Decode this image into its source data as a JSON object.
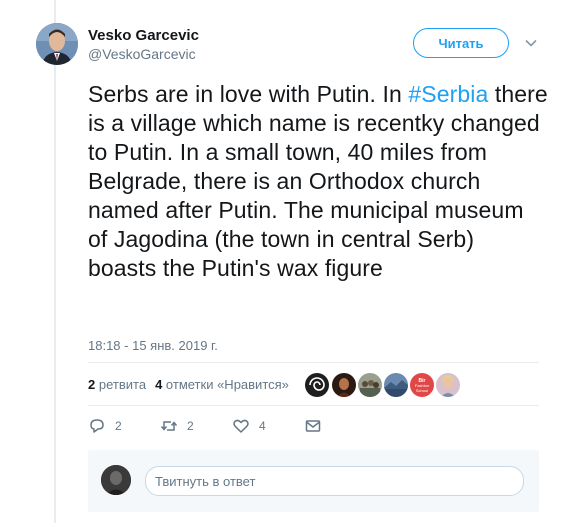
{
  "author": {
    "name": "Vesko Garcevic",
    "handle": "@VeskoGarcevic"
  },
  "follow_label": "Читать",
  "tweet": {
    "text_before": "Serbs are in love with Putin. In ",
    "hashtag": "#Serbia",
    "text_after": " there is a village which name is recentky changed to Putin. In a small town, 40 miles from Belgrade, there is an Orthodox church named after Putin. The municipal museum of Jagodina (the town in central Serb) boasts the Putin's wax figure",
    "timestamp": "18:18 - 15 янв. 2019 г."
  },
  "stats": {
    "retweets_count": "2",
    "retweets_label": "ретвита",
    "likes_count": "4",
    "likes_label": "отметки «Нравится»"
  },
  "liker_avatars": [
    {
      "icon": "spiral-logo-avatar",
      "color": "#2a2a2a"
    },
    {
      "icon": "portrait-avatar",
      "color": "#6b3a24"
    },
    {
      "icon": "group-photo-avatar",
      "color": "#8a8f80"
    },
    {
      "icon": "landscape-avatar",
      "color": "#2f4a6a"
    },
    {
      "icon": "school-logo-avatar",
      "color": "#d83a3a",
      "text": "Bir Fashion School"
    },
    {
      "icon": "portrait-avatar",
      "color": "#c9a8b8"
    }
  ],
  "actions": {
    "reply_count": "2",
    "retweet_count": "2",
    "like_count": "4"
  },
  "reply": {
    "placeholder": "Твитнуть в ответ"
  },
  "colors": {
    "accent": "#1da1f2",
    "text": "#14171a",
    "muted": "#657786",
    "divider": "#e6ecf0"
  }
}
